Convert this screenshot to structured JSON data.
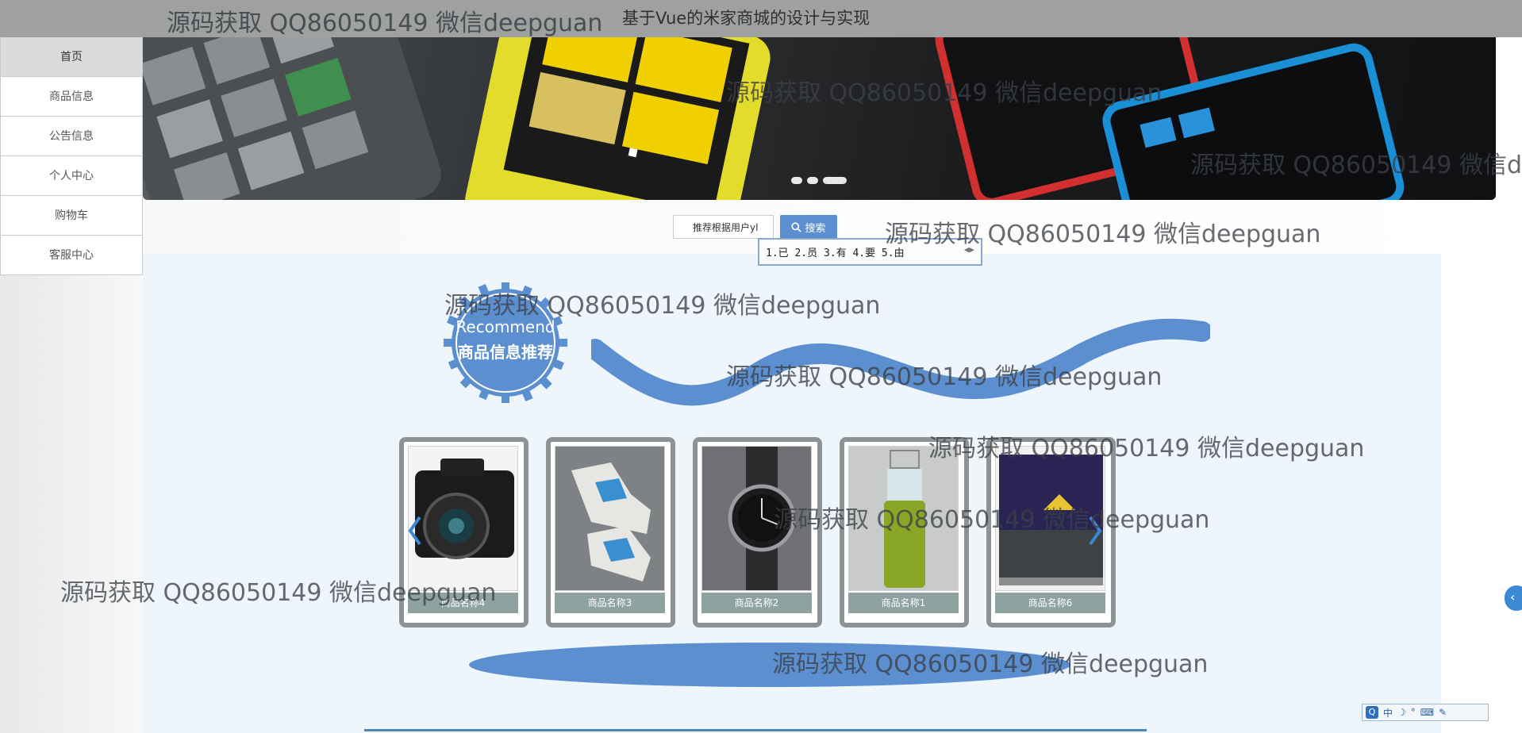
{
  "header": {
    "watermark": "源码获取 QQ86050149 微信deepguan",
    "title": "基于Vue的米家商城的设计与实现"
  },
  "sidebar": {
    "items": [
      {
        "label": "首页",
        "active": true
      },
      {
        "label": "商品信息",
        "active": false
      },
      {
        "label": "公告信息",
        "active": false
      },
      {
        "label": "个人中心",
        "active": false
      },
      {
        "label": "购物车",
        "active": false
      },
      {
        "label": "客服中心",
        "active": false
      }
    ]
  },
  "search": {
    "value": "推荐根据用户yl",
    "button_label": "搜索"
  },
  "ime": {
    "candidates": "1.已 2.员 3.有 4.要 5.由"
  },
  "recommend": {
    "title_en": "Recommend",
    "title_cn": "商品信息推荐"
  },
  "products": [
    {
      "name": "商品名称4",
      "icon": "camera"
    },
    {
      "name": "商品名称3",
      "icon": "sneaker"
    },
    {
      "name": "商品名称2",
      "icon": "watch"
    },
    {
      "name": "商品名称1",
      "icon": "bottle"
    },
    {
      "name": "商品名称6",
      "icon": "tv"
    }
  ],
  "watermarks": [
    "源码获取 QQ86050149 微信deepguan",
    "源码获取 QQ86050149 微信deepguan",
    "源码获取 QQ86050149 微信deepguan",
    "源码获取 QQ86050149 微信deepguan",
    "源码获取 QQ86050149 微信deepguan",
    "源码获取 QQ86050149 微信deepguan",
    "源码获取 QQ86050149 微信deepguan",
    "源码获取 QQ86050149 微信deepguan",
    "源码获取 QQ86050149 微信deepguan"
  ],
  "ime_toolbar": {
    "mode_label": "中"
  },
  "colors": {
    "header_bg": "#9ea1a0",
    "accent_blue": "#5b8fcf",
    "content_bg": "#eef6fc",
    "card_border": "#8d9394"
  }
}
